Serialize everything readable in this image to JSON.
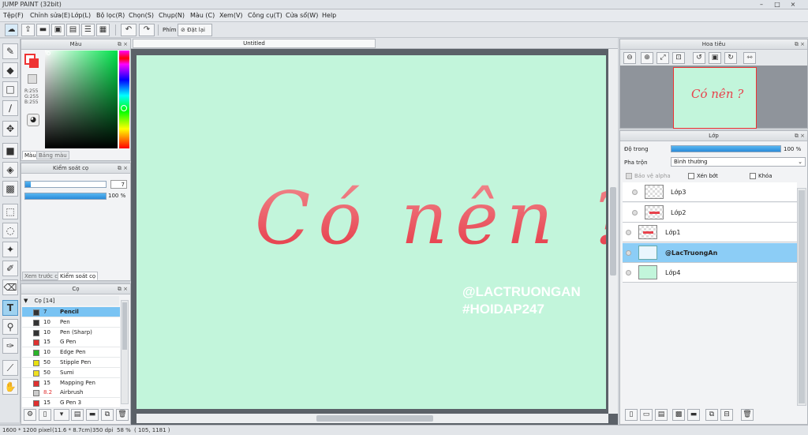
{
  "titlebar": {
    "title": "JUMP PAINT (32bit)",
    "minimize": "–",
    "maximize": "□",
    "close": "×"
  },
  "menu": [
    {
      "label": "Tệp(F)"
    },
    {
      "label": "Chỉnh sửa(E)"
    },
    {
      "label": "Lớp(L)"
    },
    {
      "label": "Bộ lọc(R)"
    },
    {
      "label": "Chọn(S)"
    },
    {
      "label": "Chụp(N)"
    },
    {
      "label": "Màu (C)"
    },
    {
      "label": "Xem(V)"
    },
    {
      "label": "Công cụ(T)"
    },
    {
      "label": "Cửa sổ(W)"
    },
    {
      "label": "Help"
    }
  ],
  "toolbar": {
    "key_label": "Phím",
    "reset_label": "Đặt lại"
  },
  "color_panel": {
    "title": "Màu",
    "r": "R:255",
    "g": "G:255",
    "b": "B:255",
    "tab_color": "Màu",
    "tab_palette": "Bảng màu"
  },
  "brush_control": {
    "title": "Kiểm soát cọ",
    "size_value": "7",
    "size_fraction": 0.07,
    "opacity_value": "100 %",
    "opacity_fraction": 1.0,
    "tab_preview": "Xem trước cọ",
    "tab_control": "Kiểm soát cọ"
  },
  "brush_panel": {
    "title": "Cọ",
    "group": "Cọ [14]",
    "brushes": [
      {
        "size": "7",
        "name": "Pencil",
        "color": "#333333"
      },
      {
        "size": "10",
        "name": "Pen",
        "color": "#333333"
      },
      {
        "size": "10",
        "name": "Pen (Sharp)",
        "color": "#333333"
      },
      {
        "size": "15",
        "name": "G Pen",
        "color": "#e03030"
      },
      {
        "size": "10",
        "name": "Edge Pen",
        "color": "#29b329"
      },
      {
        "size": "50",
        "name": "Stipple Pen",
        "color": "#e8e010"
      },
      {
        "size": "50",
        "name": "Sumi",
        "color": "#f0e020"
      },
      {
        "size": "15",
        "name": "Mapping Pen",
        "color": "#e03030"
      },
      {
        "size": "8.2",
        "name": "Airbrush",
        "color": "#cccccc"
      },
      {
        "size": "15",
        "name": "G Pen 3",
        "color": "#e03030"
      }
    ]
  },
  "document": {
    "tab_title": "Untitled",
    "main_text": "Có nên ?",
    "watermark_line1": "@LACTRUONGAN",
    "watermark_line2": "#HOIDAP247"
  },
  "navigator": {
    "title": "Hoa tiêu"
  },
  "layers": {
    "title": "Lớp",
    "opacity_label": "Độ trong",
    "opacity_value": "100 %",
    "opacity_fraction": 1.0,
    "blend_label": "Pha trộn",
    "blend_value": "Bình thường",
    "protect_alpha": "Bảo vệ alpha",
    "clip": "Xén bớt",
    "lock": "Khóa",
    "items": [
      {
        "name": "Lớp3"
      },
      {
        "name": "Lớp2"
      },
      {
        "name": "Lớp1"
      },
      {
        "name": "@LacTruongAn"
      },
      {
        "name": "Lớp4"
      }
    ]
  },
  "status": {
    "size": "1600 * 1200 pixel",
    "cm": "(11.6 * 8.7cm)",
    "dpi": "350 dpi",
    "zoom": "58 %",
    "coords": "( 105, 1181 )"
  },
  "colors": {
    "accent": "#2a8ad8",
    "canvas": "#c2f5db",
    "text_red": "#e8424c",
    "selection": "#79c3f3"
  }
}
